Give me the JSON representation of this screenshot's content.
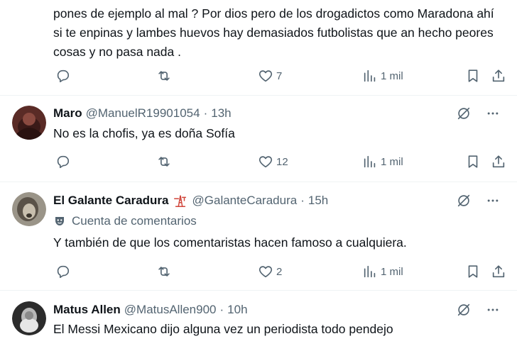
{
  "tweets": [
    {
      "text": "pones de ejemplo al mal ? Por dios pero de los drogadictos como Maradona ahí si te enpinas y lambes huevos hay demasiados futbolistas que an hecho peores cosas y no pasa nada .",
      "likes": "7",
      "views": "1 mil"
    },
    {
      "name": "Maro",
      "handle": "@ManuelR19901054",
      "time": "13h",
      "text": "No es la chofis, ya es doña Sofía",
      "likes": "12",
      "views": "1 mil"
    },
    {
      "name": "El Galante Caradura",
      "handle": "@GalanteCaradura",
      "time": "15h",
      "affiliation": "Cuenta de comentarios",
      "text": "Y también de que los comentaristas hacen famoso a cualquiera.",
      "likes": "2",
      "views": "1 mil"
    },
    {
      "name": "Matus Allen",
      "handle": "@MatusAllen900",
      "time": "10h",
      "text": "El Messi Mexicano dijo alguna vez un periodista todo pendejo"
    }
  ],
  "dot": "·",
  "icons": {
    "reply": "reply-icon",
    "retweet": "retweet-icon",
    "like": "heart-icon",
    "views": "views-icon",
    "bookmark": "bookmark-icon",
    "share": "share-icon",
    "grok": "grok-icon",
    "more": "more-icon",
    "affiliation": "mask-icon",
    "badge": "oil-rig-icon"
  }
}
